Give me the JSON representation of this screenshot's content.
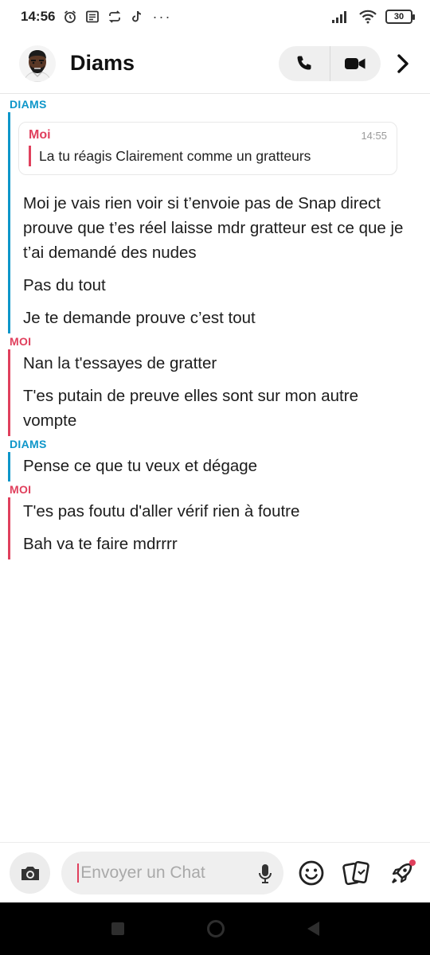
{
  "status_bar": {
    "time": "14:56",
    "dots": "···",
    "battery": "30"
  },
  "header": {
    "contact_name": "Diams",
    "call_icon": "phone-icon",
    "video_icon": "video-camera-icon",
    "next_icon": "chevron-right-icon"
  },
  "conversation": {
    "groups": [
      {
        "sender": "DIAMS",
        "side": "them",
        "reply": {
          "name": "Moi",
          "time": "14:55",
          "quote": "La tu réagis Clairement comme un gratteurs"
        },
        "messages": [
          "Moi je vais rien voir si t’envoie pas de Snap direct prouve que t’es réel laisse mdr gratteur est ce que je t’ai demandé des nudes",
          "Pas du tout",
          "Je te demande prouve c’est tout"
        ]
      },
      {
        "sender": "MOI",
        "side": "me",
        "messages": [
          "Nan la t'essayes de gratter",
          "T'es putain de preuve elles sont sur mon autre vompte"
        ]
      },
      {
        "sender": "DIAMS",
        "side": "them",
        "messages": [
          "Pense ce que tu veux et dégage"
        ]
      },
      {
        "sender": "MOI",
        "side": "me",
        "messages": [
          "T'es pas foutu d'aller vérif rien à foutre",
          "Bah va te faire mdrrrr"
        ]
      }
    ]
  },
  "composer": {
    "placeholder": "Envoyer un Chat",
    "value": ""
  },
  "colors": {
    "them": "#0d96c9",
    "me": "#e0405d"
  }
}
